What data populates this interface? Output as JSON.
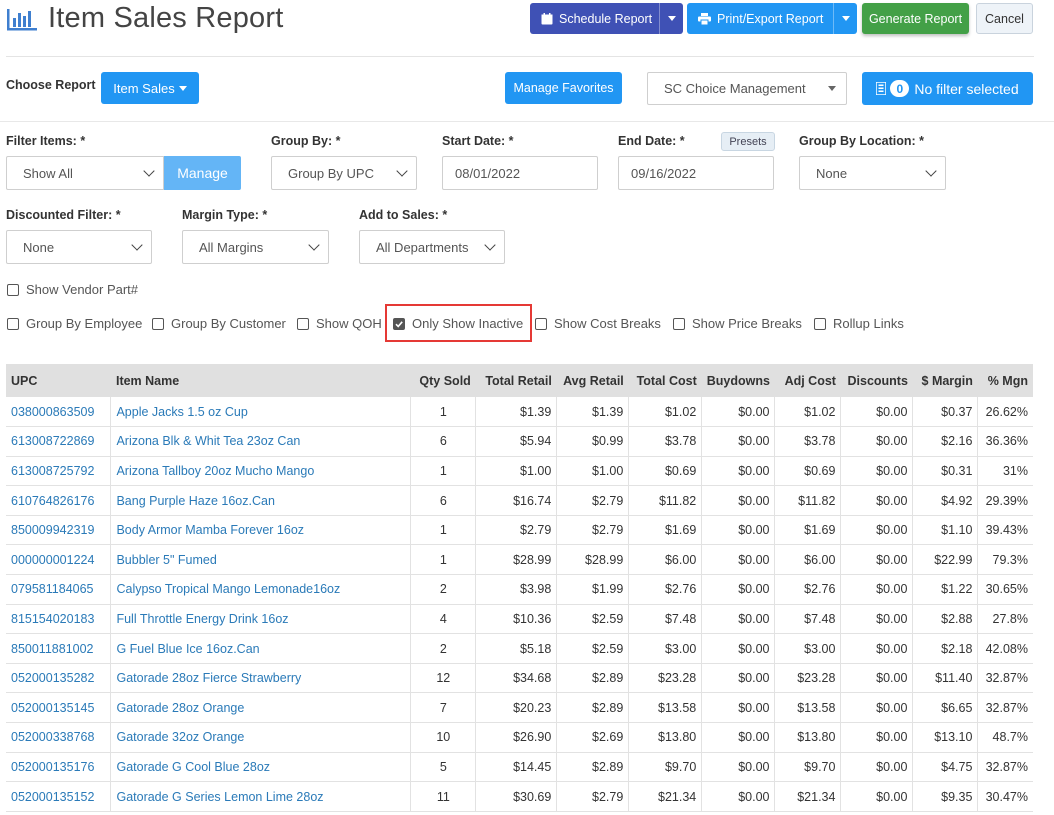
{
  "header": {
    "title": "Item Sales Report",
    "schedule_label": "Schedule Report",
    "print_label": "Print/Export Report",
    "generate_label": "Generate Report",
    "cancel_label": "Cancel"
  },
  "toolbar": {
    "choose_report_label": "Choose Report",
    "report_type": "Item Sales",
    "manage_favorites_label": "Manage Favorites",
    "company_select": "SC Choice Management",
    "filter_count": "0",
    "filter_label": "No filter selected"
  },
  "filters": {
    "filter_items_label": "Filter Items: *",
    "filter_items_value": "Show All",
    "manage_label": "Manage",
    "group_by_label": "Group By: *",
    "group_by_value": "Group By UPC",
    "start_date_label": "Start Date: *",
    "start_date_value": "08/01/2022",
    "end_date_label": "End Date: *",
    "end_date_value": "09/16/2022",
    "presets_label": "Presets",
    "group_by_location_label": "Group By Location: *",
    "group_by_location_value": "None",
    "discounted_filter_label": "Discounted Filter: *",
    "discounted_filter_value": "None",
    "margin_type_label": "Margin Type: *",
    "margin_type_value": "All Margins",
    "add_to_sales_label": "Add to Sales: *",
    "add_to_sales_value": "All Departments"
  },
  "options": {
    "show_vendor_part": "Show Vendor Part#",
    "group_by_employee": "Group By Employee",
    "group_by_customer": "Group By Customer",
    "show_qoh": "Show QOH",
    "only_show_inactive": "Only Show Inactive",
    "only_show_inactive_checked": true,
    "show_cost_breaks": "Show Cost Breaks",
    "show_price_breaks": "Show Price Breaks",
    "rollup_links": "Rollup Links"
  },
  "table": {
    "columns": [
      "UPC",
      "Item Name",
      "Qty Sold",
      "Total Retail",
      "Avg Retail",
      "Total Cost",
      "Buydowns",
      "Adj Cost",
      "Discounts",
      "$ Margin",
      "% Mgn"
    ],
    "rows": [
      [
        "038000863509",
        "Apple Jacks 1.5 oz Cup",
        "1",
        "$1.39",
        "$1.39",
        "$1.02",
        "$0.00",
        "$1.02",
        "$0.00",
        "$0.37",
        "26.62%"
      ],
      [
        "613008722869",
        "Arizona Blk & Whit Tea 23oz Can",
        "6",
        "$5.94",
        "$0.99",
        "$3.78",
        "$0.00",
        "$3.78",
        "$0.00",
        "$2.16",
        "36.36%"
      ],
      [
        "613008725792",
        "Arizona Tallboy 20oz Mucho Mango",
        "1",
        "$1.00",
        "$1.00",
        "$0.69",
        "$0.00",
        "$0.69",
        "$0.00",
        "$0.31",
        "31%"
      ],
      [
        "610764826176",
        "Bang Purple Haze 16oz.Can",
        "6",
        "$16.74",
        "$2.79",
        "$11.82",
        "$0.00",
        "$11.82",
        "$0.00",
        "$4.92",
        "29.39%"
      ],
      [
        "850009942319",
        "Body Armor Mamba Forever 16oz",
        "1",
        "$2.79",
        "$2.79",
        "$1.69",
        "$0.00",
        "$1.69",
        "$0.00",
        "$1.10",
        "39.43%"
      ],
      [
        "000000001224",
        "Bubbler 5\" Fumed",
        "1",
        "$28.99",
        "$28.99",
        "$6.00",
        "$0.00",
        "$6.00",
        "$0.00",
        "$22.99",
        "79.3%"
      ],
      [
        "079581184065",
        "Calypso Tropical Mango Lemonade16oz",
        "2",
        "$3.98",
        "$1.99",
        "$2.76",
        "$0.00",
        "$2.76",
        "$0.00",
        "$1.22",
        "30.65%"
      ],
      [
        "815154020183",
        "Full Throttle Energy Drink 16oz",
        "4",
        "$10.36",
        "$2.59",
        "$7.48",
        "$0.00",
        "$7.48",
        "$0.00",
        "$2.88",
        "27.8%"
      ],
      [
        "850011881002",
        "G Fuel Blue Ice 16oz.Can",
        "2",
        "$5.18",
        "$2.59",
        "$3.00",
        "$0.00",
        "$3.00",
        "$0.00",
        "$2.18",
        "42.08%"
      ],
      [
        "052000135282",
        "Gatorade 28oz Fierce Strawberry",
        "12",
        "$34.68",
        "$2.89",
        "$23.28",
        "$0.00",
        "$23.28",
        "$0.00",
        "$11.40",
        "32.87%"
      ],
      [
        "052000135145",
        "Gatorade 28oz Orange",
        "7",
        "$20.23",
        "$2.89",
        "$13.58",
        "$0.00",
        "$13.58",
        "$0.00",
        "$6.65",
        "32.87%"
      ],
      [
        "052000338768",
        "Gatorade 32oz Orange",
        "10",
        "$26.90",
        "$2.69",
        "$13.80",
        "$0.00",
        "$13.80",
        "$0.00",
        "$13.10",
        "48.7%"
      ],
      [
        "052000135176",
        "Gatorade G Cool Blue 28oz",
        "5",
        "$14.45",
        "$2.89",
        "$9.70",
        "$0.00",
        "$9.70",
        "$0.00",
        "$4.75",
        "32.87%"
      ],
      [
        "052000135152",
        "Gatorade G Series Lemon Lime 28oz",
        "11",
        "$30.69",
        "$2.79",
        "$21.34",
        "$0.00",
        "$21.34",
        "$0.00",
        "$9.35",
        "30.47%"
      ]
    ]
  },
  "colors": {
    "primary_blue": "#2196f3",
    "indigo": "#3f51b5",
    "green": "#43a047",
    "link": "#2a7ab8",
    "highlight_red": "#e53935"
  }
}
